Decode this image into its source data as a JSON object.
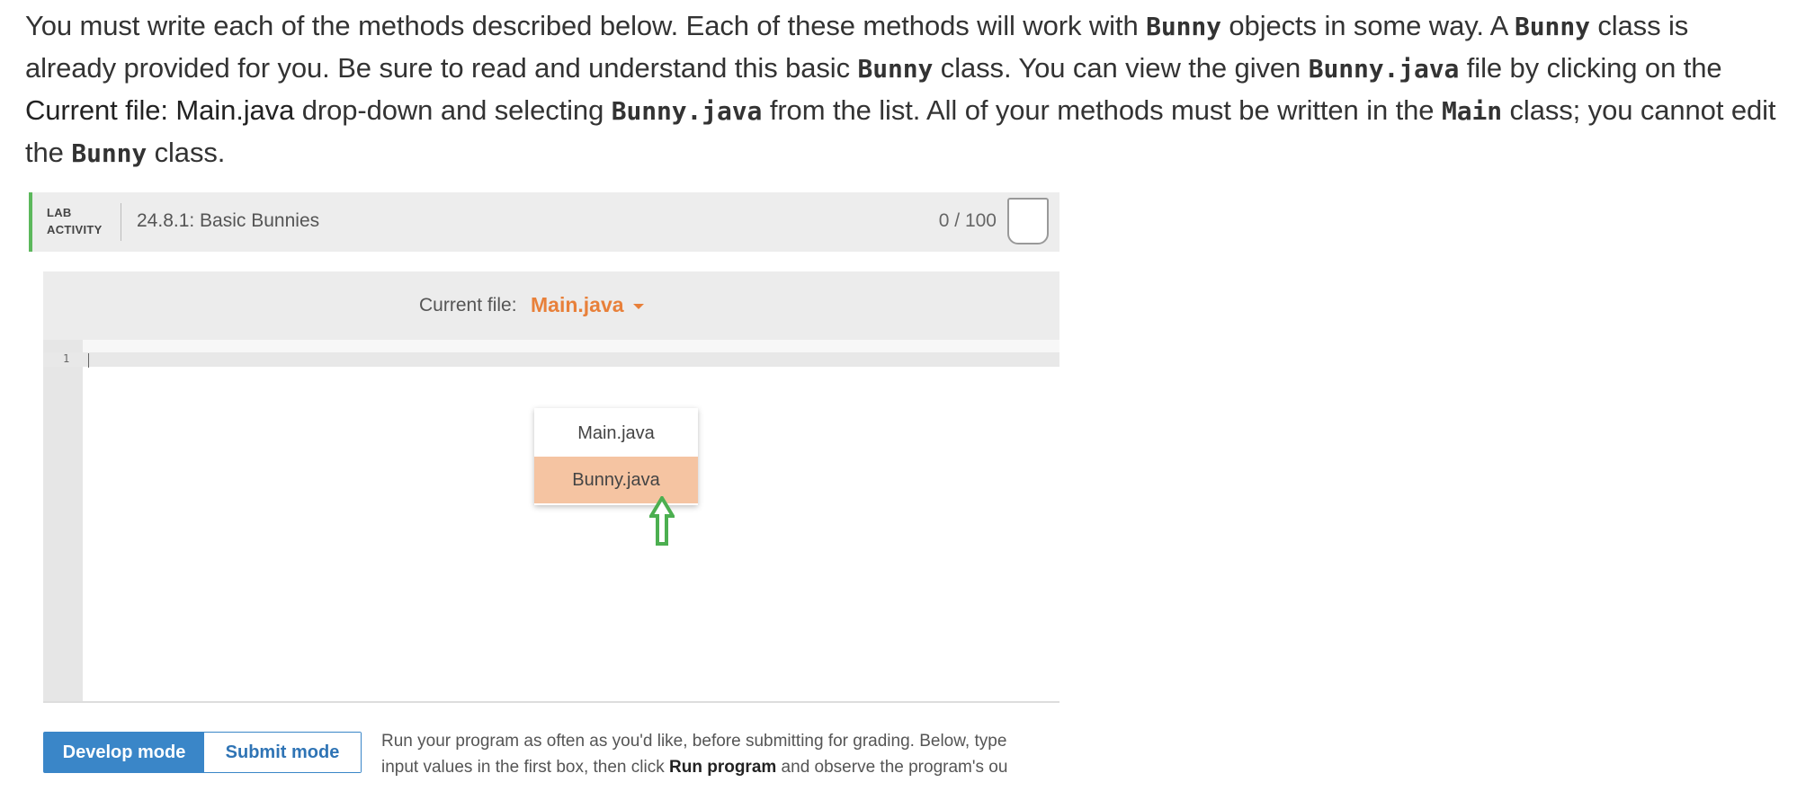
{
  "intro": {
    "t1": "You must write each of the methods described below. Each of these methods will work with ",
    "c1": "Bunny",
    "t2": " objects in some way. A ",
    "c2": "Bunny",
    "t3": " class is already provided for you. Be sure to read and understand this basic ",
    "c3": "Bunny",
    "t4": " class. You can view the given ",
    "c4": "Bunny.java",
    "t5": " file by clicking on the ",
    "b1": "Current file: Main.java",
    "t6": " drop-down and selecting ",
    "c5": "Bunny.java",
    "t7": " from the list. All of your methods must be written in the ",
    "c6": "Main",
    "t8": " class; you cannot edit the ",
    "c7": "Bunny",
    "t9": " class."
  },
  "lab": {
    "tag_line1": "LAB",
    "tag_line2": "ACTIVITY",
    "title": "24.8.1: Basic Bunnies",
    "score": "0 / 100",
    "accent_color": "#5cb85c"
  },
  "editor": {
    "file_label": "Current file:",
    "current_file": "Main.java",
    "line_number": "1",
    "dropdown_options": [
      "Main.java",
      "Bunny.java"
    ],
    "highlighted_option": "Bunny.java",
    "highlight_color": "#f5c4a2",
    "arrow_icon": "up-arrow-icon",
    "arrow_color": "#4caf50"
  },
  "modes": {
    "develop": "Develop mode",
    "submit": "Submit mode",
    "active_color": "#3a86c8"
  },
  "run_desc": {
    "line1": "Run your program as often as you'd like, before submitting for grading. Below, type",
    "line2_a": "input values in the first box, then click ",
    "line2_b": "Run program",
    "line2_c": " and observe the program's ou"
  }
}
